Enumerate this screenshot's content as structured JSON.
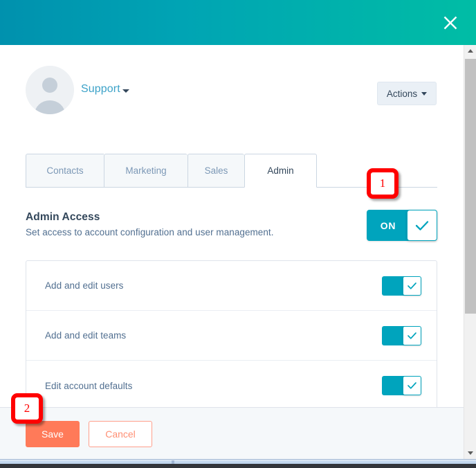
{
  "header": {
    "gradient_from": "#0091ae",
    "gradient_to": "#00bda5",
    "close_icon": "close-icon",
    "close_label": "Close"
  },
  "profile": {
    "avatar_icon": "user-avatar-icon",
    "name": "Support",
    "caret_icon": "chevron-down-icon",
    "actions_label": "Actions",
    "actions_caret_icon": "chevron-down-icon"
  },
  "tabs": [
    {
      "label": "Contacts",
      "active": false
    },
    {
      "label": "Marketing",
      "active": false
    },
    {
      "label": "Sales",
      "active": false
    },
    {
      "label": "Admin",
      "active": true
    }
  ],
  "section": {
    "title": "Admin Access",
    "subtitle": "Set access to account configuration and user management.",
    "toggle_state_label": "ON",
    "toggle_check_icon": "check-icon",
    "toggle_on": true,
    "accent_color": "#00a4bd"
  },
  "permissions": [
    {
      "label": "Add and edit users",
      "enabled": true,
      "check_icon": "check-icon"
    },
    {
      "label": "Add and edit teams",
      "enabled": true,
      "check_icon": "check-icon"
    },
    {
      "label": "Edit account defaults",
      "enabled": true,
      "check_icon": "check-icon"
    }
  ],
  "footer": {
    "save_label": "Save",
    "cancel_label": "Cancel",
    "save_color": "#ff7a59",
    "cancel_color": "#ff8f73"
  },
  "scrollbar": {
    "up_arrow_icon": "triangle-up-icon",
    "down_arrow_icon": "triangle-down-icon",
    "thumb_label": "scroll-thumb"
  },
  "annotations": [
    {
      "number": "1",
      "color": "#ff0000"
    },
    {
      "number": "2",
      "color": "#ff0000"
    }
  ]
}
